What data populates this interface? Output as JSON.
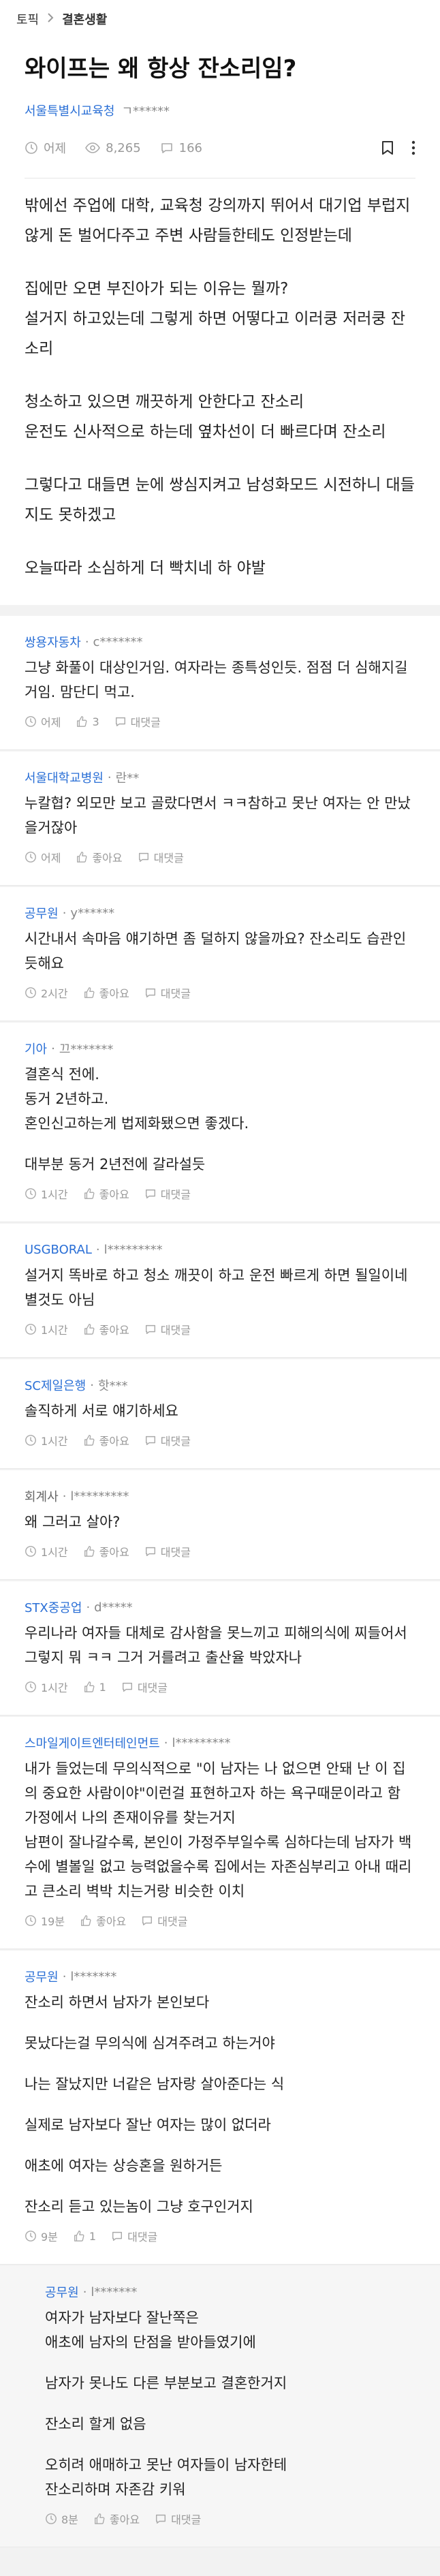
{
  "nav": {
    "community": "토픽",
    "board": "결혼생활"
  },
  "post": {
    "title": "와이프는 왜 항상 잔소리임?",
    "company": "서울특별시교육청",
    "nick": "ㄱ******",
    "time": "어제",
    "views": "8,265",
    "comments_count": "166",
    "paragraphs": [
      "밖에선 주업에 대학, 교육청 강의까지 뛰어서 대기업 부럽지 않게 돈 벌어다주고 주변 사람들한테도 인정받는데",
      "집에만 오면 부진아가 되는 이유는 뭘까?\n설거지 하고있는데 그렇게 하면 어떻다고 이러쿵 저러쿵 잔소리",
      "청소하고 있으면 깨끗하게 안한다고 잔소리\n운전도 신사적으로 하는데 옆차선이 더 빠르다며 잔소리",
      "그렇다고 대들면 눈에 쌍심지켜고 남성화모드 시전하니 대들지도 못하겠고",
      "오늘따라 소심하게 더 빡치네 하 야발"
    ]
  },
  "labels": {
    "like": "좋아요",
    "reply": "대댓글"
  },
  "comments": [
    {
      "company": "쌍용자동차",
      "nick": "c*******",
      "gray": false,
      "paragraphs": [
        "그냥 화풀이 대상인거임. 여자라는 종특성인듯. 점점 더 심해지길거임. 맘단디 먹고."
      ],
      "time": "어제",
      "likes": "3"
    },
    {
      "company": "서울대학교병원",
      "nick": "란**",
      "gray": false,
      "paragraphs": [
        "누칼협? 외모만 보고 골랐다면서 ㅋㅋ참하고 못난 여자는 안 만났을거잖아"
      ],
      "time": "어제",
      "likes": ""
    },
    {
      "company": "공무원",
      "nick": "y******",
      "gray": false,
      "paragraphs": [
        "시간내서 속마음 얘기하면 좀 덜하지 않을까요? 잔소리도 습관인듯해요"
      ],
      "time": "2시간",
      "likes": ""
    },
    {
      "company": "기아",
      "nick": "끄*******",
      "gray": false,
      "paragraphs": [
        "결혼식 전에.\n동거 2년하고.\n혼인신고하는게 법제화됐으면 좋겠다.",
        "대부분 동거 2년전에 갈라설듯"
      ],
      "time": "1시간",
      "likes": ""
    },
    {
      "company": "USGBORAL",
      "nick": "l*********",
      "gray": false,
      "paragraphs": [
        "설거지 똑바로 하고 청소 깨끗이 하고 운전 빠르게 하면 될일이네 별것도 아님"
      ],
      "time": "1시간",
      "likes": ""
    },
    {
      "company": "SC제일은행",
      "nick": "핫***",
      "gray": false,
      "paragraphs": [
        "솔직하게 서로 얘기하세요"
      ],
      "time": "1시간",
      "likes": ""
    },
    {
      "company": "회계사",
      "nick": "l*********",
      "gray": true,
      "paragraphs": [
        "왜 그러고 살아?"
      ],
      "time": "1시간",
      "likes": ""
    },
    {
      "company": "STX중공업",
      "nick": "d*****",
      "gray": false,
      "paragraphs": [
        "우리나라 여자들 대체로 감사함을 못느끼고 피해의식에 찌들어서 그렇지 뭐 ㅋㅋ 그거 거를려고 출산율 박았자나"
      ],
      "time": "1시간",
      "likes": "1"
    },
    {
      "company": "스마일게이트엔터테인먼트",
      "nick": "l*********",
      "gray": false,
      "paragraphs": [
        "내가 들었는데 무의식적으로 \"이 남자는 나 없으면 안돼 난 이 집의 중요한 사람이야\"이런걸 표현하고자 하는 욕구때문이라고 함 가정에서 나의 존재이유를 찾는거지\n남편이 잘나갈수록, 본인이 가정주부일수록 심하다는데 남자가 백수에 별볼일 없고 능력없을수록 집에서는 자존심부리고 아내 때리고 큰소리 벽박 치는거랑 비슷한 이치"
      ],
      "time": "19분",
      "likes": ""
    },
    {
      "company": "공무원",
      "nick": "l*******",
      "gray": false,
      "paragraphs": [
        "잔소리 하면서 남자가 본인보다",
        "못났다는걸 무의식에 심겨주려고 하는거야",
        "나는 잘났지만 너같은 남자랑 살아준다는 식",
        "실제로 남자보다 잘난 여자는 많이 없더라",
        "애초에 여자는 상승혼을 원하거든",
        "잔소리 듣고 있는놈이 그냥 호구인거지"
      ],
      "time": "9분",
      "likes": "1"
    }
  ],
  "reply": {
    "company": "공무원",
    "nick": "l*******",
    "paragraphs": [
      "여자가 남자보다 잘난쪽은\n애초에 남자의 단점을 받아들였기에",
      "남자가 못나도 다른 부분보고 결혼한거지",
      "잔소리 할게 없음",
      "오히려 애매하고 못난 여자들이 남자한테\n잔소리하며 자존감 키워"
    ],
    "time": "8분",
    "likes": ""
  },
  "icons": {
    "clock": "clock-icon",
    "eye": "eye-icon",
    "comment": "comment-bubble-icon",
    "bookmark": "bookmark-icon",
    "more": "more-vertical-icon",
    "thumb": "thumbs-up-icon",
    "chevron": "chevron-right-icon"
  },
  "colors": {
    "company": "#2a6fd6",
    "muted": "#999999"
  }
}
